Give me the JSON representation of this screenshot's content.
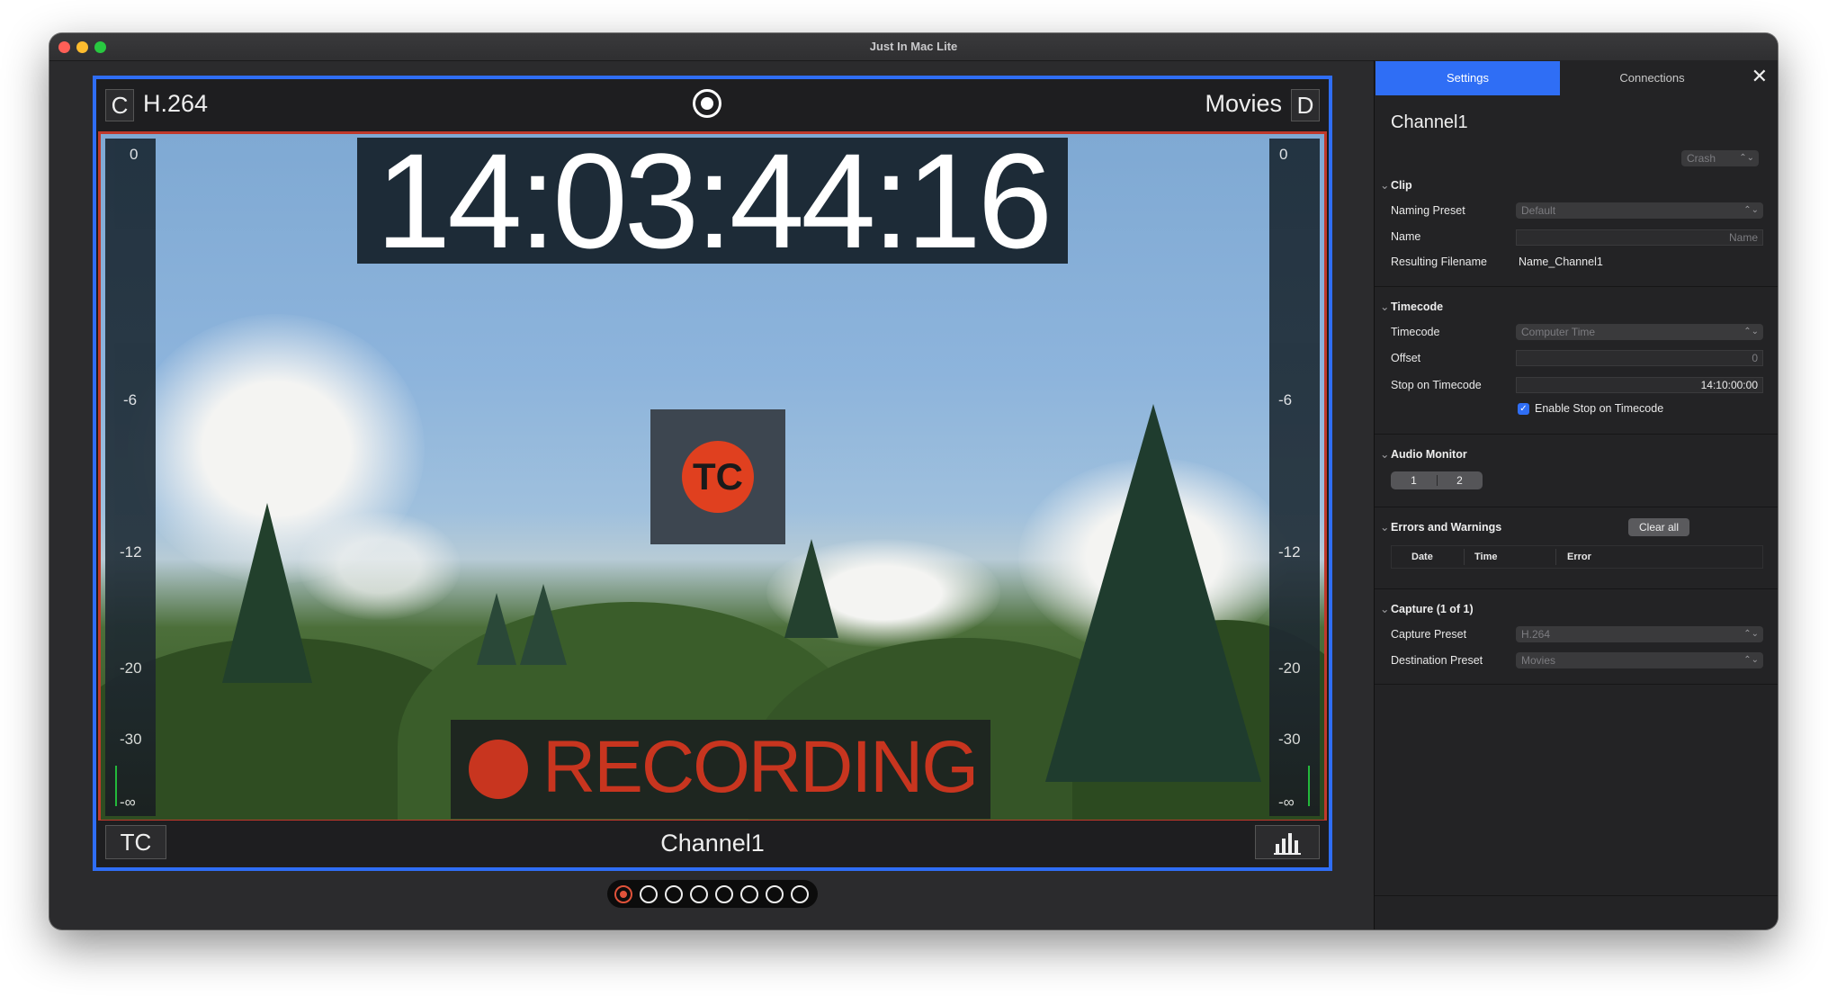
{
  "window": {
    "title": "Just In Mac Lite"
  },
  "monitor": {
    "top_left_letter": "C",
    "codec": "H.264",
    "destination": "Movies",
    "top_right_letter": "D",
    "timecode": "14:03:44:16",
    "tc_badge": "TC",
    "recording_label": "RECORDING",
    "meter_scale": [
      "0",
      "-6",
      "-12",
      "-20",
      "-30",
      "-∞"
    ],
    "tc_button": "TC",
    "channel_name": "Channel1"
  },
  "pager": {
    "count": 8,
    "active_index": 0
  },
  "settings": {
    "tabs": [
      "Settings",
      "Connections"
    ],
    "close_glyph": "✕",
    "channel_title": "Channel1",
    "crash_popup": "Crash",
    "clip": {
      "heading": "Clip",
      "naming_preset_label": "Naming Preset",
      "naming_preset_value": "Default",
      "name_label": "Name",
      "name_placeholder": "Name",
      "resulting_filename_label": "Resulting Filename",
      "resulting_filename_value": "Name_Channel1"
    },
    "timecode": {
      "heading": "Timecode",
      "timecode_label": "Timecode",
      "timecode_value": "Computer Time",
      "offset_label": "Offset",
      "offset_value": "0",
      "stop_label": "Stop on Timecode",
      "stop_value": "14:10:00:00",
      "enable_label": "Enable Stop on Timecode",
      "enable_checked": true
    },
    "audio_monitor": {
      "heading": "Audio Monitor",
      "channels": [
        "1",
        "2"
      ]
    },
    "errors": {
      "heading": "Errors and Warnings",
      "clear_all": "Clear all",
      "columns": [
        "Date",
        "Time",
        "Error"
      ]
    },
    "capture": {
      "heading": "Capture (1 of 1)",
      "capture_preset_label": "Capture Preset",
      "capture_preset_value": "H.264",
      "destination_preset_label": "Destination Preset",
      "destination_preset_value": "Movies"
    }
  },
  "colors": {
    "accent_blue": "#2f6ef5",
    "recording_red": "#c8351f",
    "tc_orange": "#e0401f"
  }
}
